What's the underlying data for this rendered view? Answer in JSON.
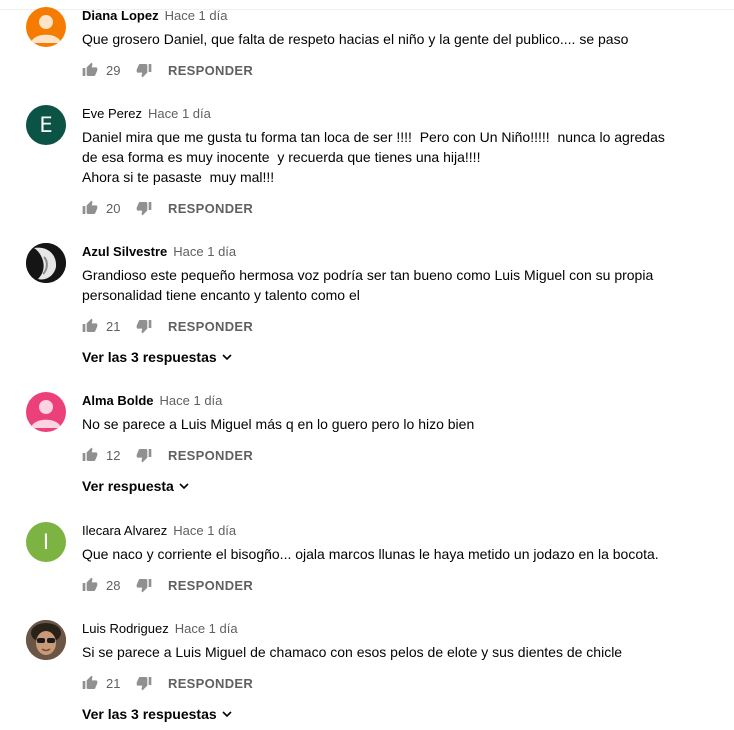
{
  "colors": {
    "avatar_orange": "#f57c00",
    "avatar_teal": "#0b5345",
    "avatar_pink": "#ec407a",
    "avatar_green": "#7cb342",
    "meta_text": "#606060"
  },
  "icons": {
    "like": "thumb-up-icon",
    "dislike": "thumb-down-icon",
    "expand": "chevron-down-icon",
    "default_avatar": "person-icon"
  },
  "comments": [
    {
      "author": "Diana Lopez",
      "time": "Hace 1 día",
      "text": "Que grosero Daniel, que falta de respeto hacias el niño y la gente del publico.... se paso",
      "likes": "29",
      "reply_label": "RESPONDER"
    },
    {
      "author": "Eve Perez",
      "avatar_letter": "E",
      "time": "Hace 1 día",
      "text": "Daniel mira que me gusta tu forma tan loca de ser !!!!  Pero con Un Niño!!!!!  nunca lo agredas\nde esa forma es muy inocente  y recuerda que tienes una hija!!!!\nAhora si te pasaste  muy mal!!!",
      "likes": "20",
      "reply_label": "RESPONDER"
    },
    {
      "author": "Azul Silvestre",
      "time": "Hace 1 día",
      "text": "Grandioso este pequeño hermosa voz podría ser tan bueno como Luis Miguel con su propia\npersonalidad tiene encanto y talento como el",
      "likes": "21",
      "reply_label": "RESPONDER",
      "replies_label": "Ver las 3 respuestas"
    },
    {
      "author": "Alma Bolde",
      "time": "Hace 1 día",
      "text": "No se parece a Luis Miguel más q en lo guero pero lo hizo bien",
      "likes": "12",
      "reply_label": "RESPONDER",
      "replies_label": "Ver respuesta"
    },
    {
      "author": "Ilecara Alvarez",
      "avatar_letter": "I",
      "time": "Hace 1 día",
      "text": "Que naco y corriente el bisogño... ojala marcos llunas le haya metido un jodazo en la bocota.",
      "likes": "28",
      "reply_label": "RESPONDER"
    },
    {
      "author": "Luis Rodriguez",
      "time": "Hace 1 día",
      "text": "Si se parece a Luis Miguel de chamaco con esos pelos de elote y sus dientes de chicle",
      "likes": "21",
      "reply_label": "RESPONDER",
      "replies_label": "Ver las 3 respuestas"
    }
  ]
}
